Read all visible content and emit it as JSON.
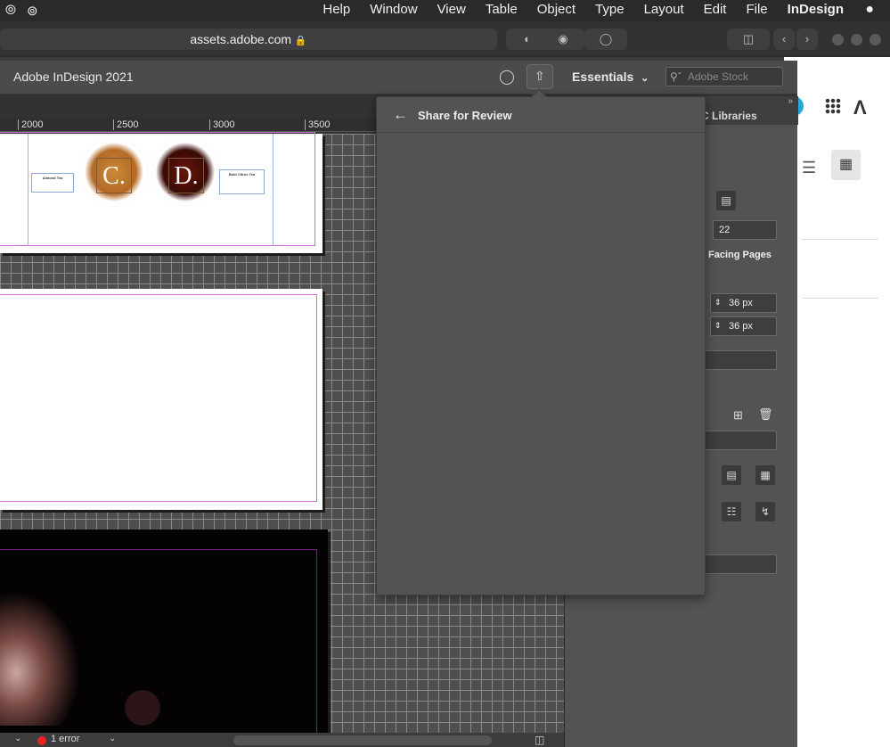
{
  "menubar": {
    "items": [
      "InDesign",
      "File",
      "Edit",
      "Layout",
      "Object",
      "Type",
      "Table",
      "View",
      "Window",
      "Help"
    ],
    "active": "InDesign",
    "icons": [
      "creative-cloud-icon",
      "cc-libraries-icon",
      "apple-icon"
    ]
  },
  "browser": {
    "url": "assets.adobe.com",
    "icons": [
      "lock-icon",
      "shield-icon",
      "grammarly-icon",
      "extension-icon",
      "sidebar-icon",
      "back-icon",
      "forward-icon"
    ]
  },
  "app": {
    "title": "Adobe InDesign 2021",
    "workspace": "Essentials",
    "search_placeholder": "Adobe Stock",
    "icons": [
      "lightbulb-icon",
      "share-icon",
      "chevron-down-icon",
      "search-icon"
    ]
  },
  "ruler": {
    "ticks": [
      "2000",
      "2500",
      "3000",
      "3500"
    ]
  },
  "document": {
    "cup_letters": [
      "C.",
      "D."
    ],
    "frame_left_title": "Almond Tea",
    "frame_right_title": "Bold Citrus Tea"
  },
  "share_popover": {
    "title": "Share for Review"
  },
  "panel": {
    "tab_label": "C Libraries",
    "pages_count": "22",
    "facing_pages_label": "Facing Pages",
    "width_value": "36 px",
    "height_value": "36 px"
  },
  "status": {
    "errors": "1 error"
  },
  "colors": {
    "menubar_bg": "#2a2a2c",
    "app_chrome": "#4b4b4b",
    "panel_bg": "#535353",
    "error_red": "#e22222",
    "margin_magenta": "#d06bd8"
  }
}
